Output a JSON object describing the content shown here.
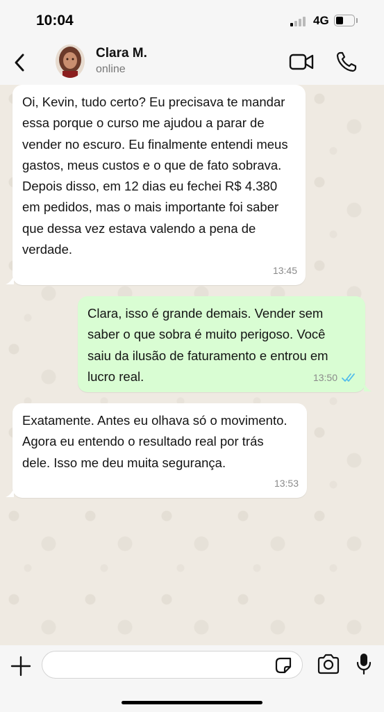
{
  "status_bar": {
    "time": "10:04",
    "network": "4G",
    "battery_level": 0.4
  },
  "header": {
    "contact_name": "Clara M.",
    "contact_status": "online",
    "icons": [
      "back-chevron-icon",
      "video-call-icon",
      "phone-icon"
    ]
  },
  "messages": [
    {
      "direction": "incoming",
      "text": "Oi, Kevin, tudo certo? Eu precisava te mandar essa porque o curso me ajudou a parar de vender no escuro. Eu finalmente entendi meus gastos, meus custos e o que de fato sobrava. Depois disso, em 12 dias eu fechei R$ 4.380 em pedidos, mas o mais importante foi saber que dessa vez estava valendo a pena de verdade.",
      "time": "13:45"
    },
    {
      "direction": "outgoing",
      "text": "Clara, isso é grande demais. Vender sem saber o que sobra é muito perigoso. Você saiu da ilusão de faturamento e entrou em lucro real.",
      "time": "13:50",
      "read_receipt": "double-check-blue"
    },
    {
      "direction": "incoming",
      "text": "Exatamente. Antes eu olhava só o movimento. Agora eu entendo o resultado real por trás dele. Isso me deu muita segurança.",
      "time": "13:53"
    }
  ],
  "input_bar": {
    "placeholder": "",
    "icons": [
      "plus-icon",
      "sticker-icon",
      "camera-icon",
      "microphone-icon"
    ]
  },
  "colors": {
    "outgoing_bubble": "#d9fdd3",
    "incoming_bubble": "#ffffff",
    "chat_background": "#efeae2",
    "read_receipt": "#53bdeb"
  }
}
